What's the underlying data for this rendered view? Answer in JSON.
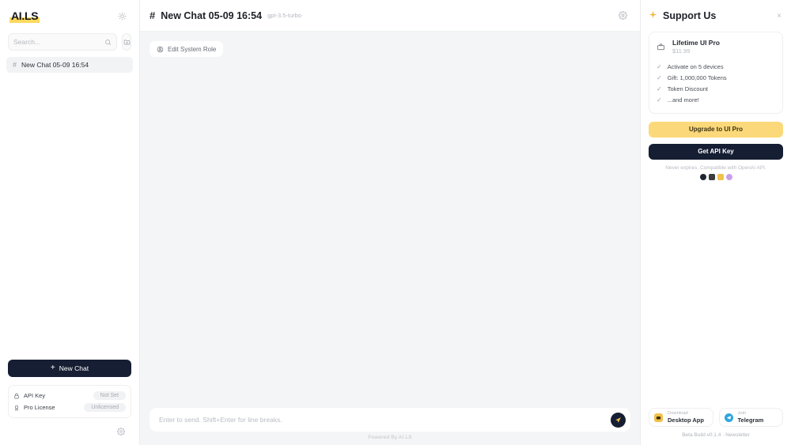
{
  "sidebar": {
    "logo": "AI.LS",
    "theme_toggle_icon": "sun-icon",
    "search": {
      "placeholder": "Search...",
      "value": "",
      "icon": "search-icon"
    },
    "new_folder_icon": "new-folder-icon",
    "chats": [
      {
        "hash": "#",
        "title": "New Chat 05-09 16:54"
      }
    ],
    "new_chat": {
      "plus": "+",
      "label": "New Chat"
    },
    "status": [
      {
        "icon": "lock-icon",
        "label": "API Key",
        "value": "Not Set"
      },
      {
        "icon": "medal-icon",
        "label": "Pro License",
        "value": "Unlicensed"
      }
    ],
    "settings_icon": "gear-icon"
  },
  "main": {
    "header": {
      "hash": "#",
      "title": "New Chat 05-09 16:54",
      "model": "gpt-3.5-turbo",
      "settings_icon": "gear-icon"
    },
    "system_role_button": {
      "icon": "user-icon",
      "label": "Edit System Role"
    },
    "composer": {
      "placeholder": "Enter to send. Shift+Enter for line breaks.",
      "value": "",
      "send_icon": "send-plane-icon"
    },
    "footer": "Powered By AI.LS"
  },
  "right_panel": {
    "sparkle_icon": "sparkle-icon",
    "title": "Support Us",
    "close_label": "×",
    "pro_card": {
      "icon": "briefcase-icon",
      "name": "Lifetime UI Pro",
      "price": "$11.99",
      "features": [
        "Activate on 5 devices",
        "Gift: 1,000,000 Tokens",
        "Token Discount",
        "...and more!"
      ]
    },
    "upgrade_label": "Upgrade to UI Pro",
    "api_key_label": "Get API Key",
    "never_expires": "Never expires. Compatible with OpenAI API.",
    "brand_icons": [
      {
        "name": "github-icon",
        "color": "#1f2430"
      },
      {
        "name": "wallet-icon",
        "color": "#3c3c3c"
      },
      {
        "name": "card-icon",
        "color": "#f2c14b"
      },
      {
        "name": "openai-icon",
        "color": "#c9a0e8"
      }
    ],
    "links": [
      {
        "icon": "robot-icon",
        "icon_color": "#f2c14b",
        "top": "Download",
        "bottom": "Desktop App"
      },
      {
        "icon": "telegram-icon",
        "icon_color": "#2fa5e0",
        "top": "Join",
        "bottom": "Telegram"
      }
    ],
    "beta_line": "Beta Build v0.1.4 · Newsletter"
  },
  "colors": {
    "accent_yellow": "#fbd97a",
    "dark_navy": "#161e33",
    "canvas_gray": "#f4f5f7"
  }
}
